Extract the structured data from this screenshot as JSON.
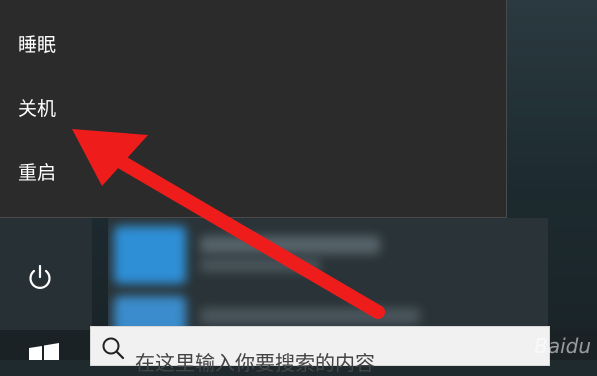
{
  "power_menu": {
    "items": [
      {
        "label": "睡眠"
      },
      {
        "label": "关机"
      },
      {
        "label": "重启"
      }
    ]
  },
  "start_menu": {
    "power_icon": "power-icon"
  },
  "taskbar": {
    "start_icon": "windows-logo-icon",
    "search_placeholder": "在这里输入你要搜索的内容"
  },
  "annotation": {
    "arrow_color": "#ef1c1c"
  },
  "watermark": {
    "text": "Baidu"
  },
  "colors": {
    "menu_bg": "#2b2b2b",
    "menu_text": "#ffffff",
    "taskbar_bg": "#1b2226"
  }
}
